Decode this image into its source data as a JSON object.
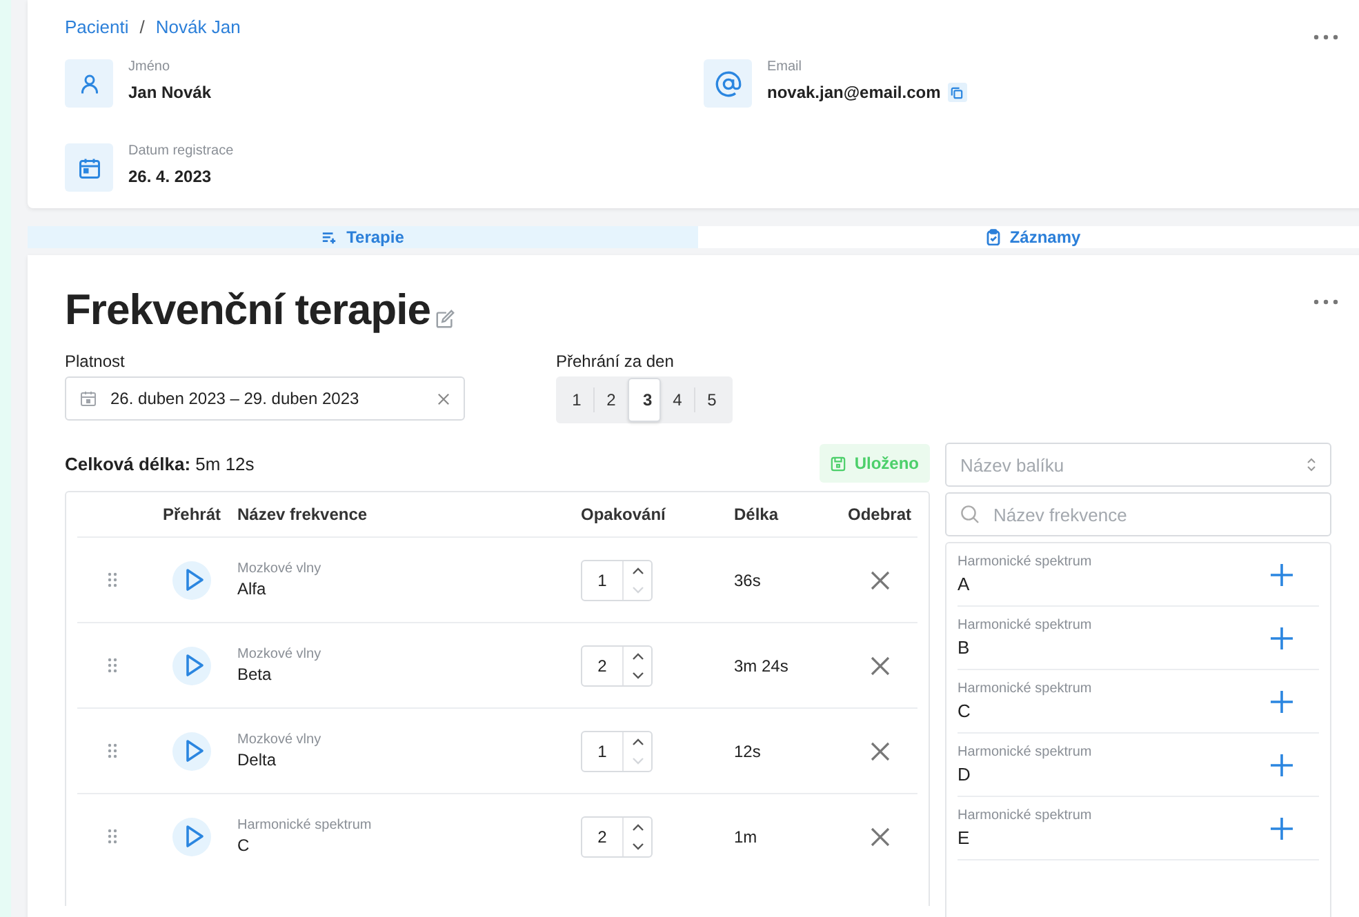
{
  "breadcrumb": [
    {
      "label": "Pacienti"
    },
    {
      "label": "Novák Jan"
    }
  ],
  "breadcrumb_separator": "/",
  "patient_fields": [
    {
      "kind": "person",
      "label": "Jméno",
      "value": "Jan Novák",
      "copyable": false
    },
    {
      "kind": "email",
      "label": "Email",
      "value": "novak.jan@email.com",
      "copyable": true
    },
    {
      "kind": "date",
      "label": "Datum registrace",
      "value": "26. 4. 2023",
      "copyable": false
    }
  ],
  "tabs": [
    {
      "label": "Terapie",
      "kind": "list",
      "selected": true
    },
    {
      "label": "Záznamy",
      "kind": "clipboard",
      "selected": false
    }
  ],
  "therapy": {
    "title": "Frekvenční terapie",
    "validity": {
      "label": "Platnost",
      "value": "26. duben 2023 – 29. duben 2023"
    },
    "plays_per_day": {
      "label": "Přehrání za den",
      "options": [
        {
          "label": "1",
          "selected": false
        },
        {
          "label": "2",
          "selected": false
        },
        {
          "label": "3",
          "selected": true
        },
        {
          "label": "4",
          "selected": false
        },
        {
          "label": "5",
          "selected": false
        }
      ]
    },
    "total_length": "**Celková délka:** 5m 12s",
    "save_status": "Uloženo",
    "columns": [
      "Přehrát",
      "Název frekvence",
      "Opakování",
      "Délka",
      "Odebrat"
    ],
    "rows": [
      {
        "category": "Mozkové vlny",
        "name": "Alfa",
        "repeats": "1",
        "down_disabled": true,
        "length": "36s"
      },
      {
        "category": "Mozkové vlny",
        "name": "Beta",
        "repeats": "2",
        "down_disabled": false,
        "length": "3m 24s"
      },
      {
        "category": "Mozkové vlny",
        "name": "Delta",
        "repeats": "1",
        "down_disabled": true,
        "length": "12s"
      },
      {
        "category": "Harmonické spektrum",
        "name": "C",
        "repeats": "2",
        "down_disabled": false,
        "length": "1m"
      }
    ],
    "package_select": {
      "placeholder": "Název balíku"
    },
    "frequency_search": {
      "placeholder": "Název frekvence"
    },
    "library": [
      {
        "category": "Harmonické spektrum",
        "name": "A"
      },
      {
        "category": "Harmonické spektrum",
        "name": "B"
      },
      {
        "category": "Harmonické spektrum",
        "name": "C"
      },
      {
        "category": "Harmonické spektrum",
        "name": "D"
      },
      {
        "category": "Harmonické spektrum",
        "name": "E"
      }
    ]
  }
}
